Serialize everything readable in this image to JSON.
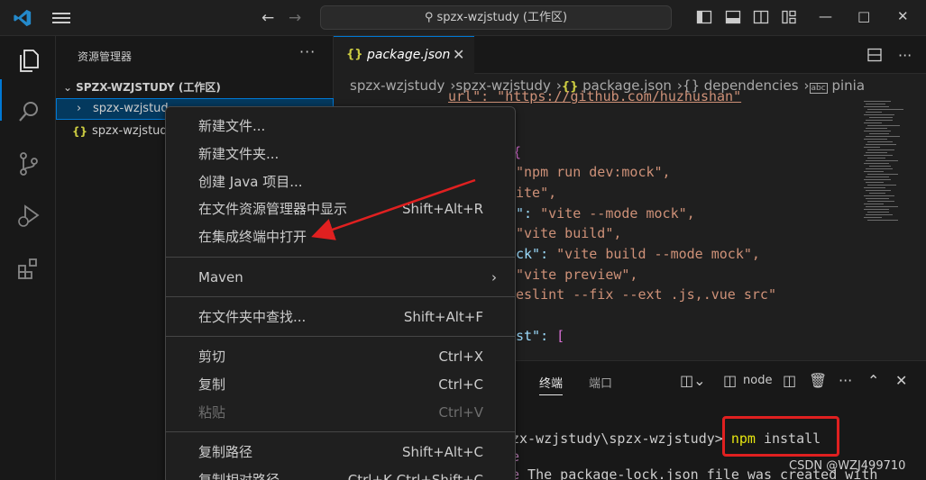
{
  "titlebar": {
    "search_text": "spzx-wzjstudy (工作区)"
  },
  "sidebar": {
    "title": "资源管理器",
    "more": "···",
    "workspace": "SPZX-WZJSTUDY (工作区)",
    "items": [
      {
        "label": "spzx-wzjstud"
      },
      {
        "label": "spzx-wzjstud"
      }
    ]
  },
  "editor": {
    "tab_label": "package.json",
    "tab_icon": "{}",
    "breadcrumb": [
      "spzx-wzjstudy",
      "spzx-wzjstudy",
      "package.json",
      "dependencies",
      "pinia"
    ],
    "breadcrumb_json_icon": "{}",
    "breadcrumb_obj_icon": "{}",
    "breadcrumb_str_icon": "abc",
    "code": {
      "l0": "url\": \"https://github.com/huzhushan\"",
      "l1": "{",
      "l2": "\"npm run dev:mock\",",
      "l3": "ite\",",
      "l4a": "\": ",
      "l4b": "\"vite --mode mock\",",
      "l5": "\"vite build\",",
      "l6a": "ck\": ",
      "l6b": "\"vite build --mode mock\",",
      "l7": "\"vite preview\",",
      "l8": "eslint --fix --ext .js,.vue src\"",
      "l9a": "st\": ",
      "l9b": "["
    }
  },
  "panel": {
    "tab_terminal": "终端",
    "tab_ports": "端口",
    "node_label": "node",
    "line1_path": "zx-wzjstudy\\spzx-wzjstudy> ",
    "line1_cmd": "npm",
    "line1_arg": " install",
    "line2": "e",
    "line3a": "e",
    "line3b": " The package-lock.json file was created with"
  },
  "context_menu": {
    "items": [
      {
        "label": "新建文件...",
        "shortcut": ""
      },
      {
        "label": "新建文件夹...",
        "shortcut": ""
      },
      {
        "label": "创建 Java 项目...",
        "shortcut": ""
      },
      {
        "label": "在文件资源管理器中显示",
        "shortcut": "Shift+Alt+R"
      },
      {
        "label": "在集成终端中打开",
        "shortcut": ""
      },
      {
        "label": "Maven",
        "shortcut": ""
      },
      {
        "label": "在文件夹中查找...",
        "shortcut": "Shift+Alt+F"
      },
      {
        "label": "剪切",
        "shortcut": "Ctrl+X"
      },
      {
        "label": "复制",
        "shortcut": "Ctrl+C"
      },
      {
        "label": "粘贴",
        "shortcut": "Ctrl+V"
      },
      {
        "label": "复制路径",
        "shortcut": "Shift+Alt+C"
      },
      {
        "label": "复制相对路径",
        "shortcut": "Ctrl+K Ctrl+Shift+C"
      }
    ]
  },
  "watermark": "CSDN @WZJ499710",
  "colors": {
    "accent": "#0078d4",
    "annotation_red": "#e02020",
    "json_icon": "#cbcb41"
  }
}
